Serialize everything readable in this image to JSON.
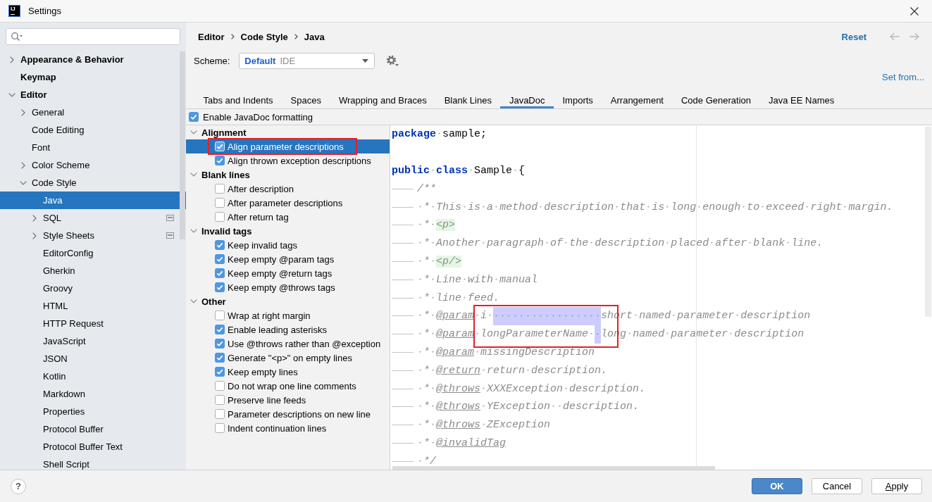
{
  "window": {
    "title": "Settings",
    "logo": "IJ"
  },
  "sidebar": {
    "items": [
      {
        "label": "Appearance & Behavior",
        "expanded": false,
        "selected": false
      },
      {
        "label": "Keymap",
        "selected": false
      },
      {
        "label": "Editor",
        "expanded": true,
        "selected": false,
        "children": [
          {
            "label": "General",
            "expanded": false,
            "selected": false
          },
          {
            "label": "Code Editing",
            "selected": false
          },
          {
            "label": "Font",
            "selected": false
          },
          {
            "label": "Color Scheme",
            "expanded": false,
            "selected": false
          },
          {
            "label": "Code Style",
            "expanded": true,
            "selected": false,
            "children": [
              {
                "label": "Java",
                "selected": true
              },
              {
                "label": "SQL",
                "expanded": false,
                "selected": false,
                "scheme_icon": true
              },
              {
                "label": "Style Sheets",
                "expanded": false,
                "selected": false,
                "scheme_icon": true
              },
              {
                "label": "EditorConfig",
                "selected": false
              },
              {
                "label": "Gherkin",
                "selected": false
              },
              {
                "label": "Groovy",
                "selected": false
              },
              {
                "label": "HTML",
                "selected": false
              },
              {
                "label": "HTTP Request",
                "selected": false
              },
              {
                "label": "JavaScript",
                "selected": false
              },
              {
                "label": "JSON",
                "selected": false
              },
              {
                "label": "Kotlin",
                "selected": false
              },
              {
                "label": "Markdown",
                "selected": false
              },
              {
                "label": "Properties",
                "selected": false
              },
              {
                "label": "Protocol Buffer",
                "selected": false
              },
              {
                "label": "Protocol Buffer Text",
                "selected": false
              },
              {
                "label": "Shell Script",
                "selected": false
              }
            ]
          }
        ]
      }
    ]
  },
  "header": {
    "breadcrumb": [
      "Editor",
      "Code Style",
      "Java"
    ],
    "reset": "Reset",
    "back": {
      "disabled": true
    },
    "forward": {
      "disabled": true
    },
    "scheme": {
      "label": "Scheme:",
      "value": "Default",
      "scope": "IDE"
    },
    "set_from": "Set from..."
  },
  "tabs": [
    {
      "label": "Tabs and Indents",
      "selected": false
    },
    {
      "label": "Spaces",
      "selected": false
    },
    {
      "label": "Wrapping and Braces",
      "selected": false
    },
    {
      "label": "Blank Lines",
      "selected": false
    },
    {
      "label": "JavaDoc",
      "selected": true
    },
    {
      "label": "Imports",
      "selected": false
    },
    {
      "label": "Arrangement",
      "selected": false
    },
    {
      "label": "Code Generation",
      "selected": false
    },
    {
      "label": "Java EE Names",
      "selected": false
    }
  ],
  "enable_javadoc": {
    "label": "Enable JavaDoc formatting",
    "checked": true
  },
  "options": [
    {
      "label": "Alignment",
      "expanded": true,
      "children": [
        {
          "label": "Align parameter descriptions",
          "checked": true,
          "selected": true,
          "highlighted": true
        },
        {
          "label": "Align thrown exception descriptions",
          "checked": true,
          "selected": false
        }
      ]
    },
    {
      "label": "Blank lines",
      "expanded": true,
      "children": [
        {
          "label": "After description",
          "checked": false,
          "selected": false
        },
        {
          "label": "After parameter descriptions",
          "checked": false,
          "selected": false
        },
        {
          "label": "After return tag",
          "checked": false,
          "selected": false
        }
      ]
    },
    {
      "label": "Invalid tags",
      "expanded": true,
      "children": [
        {
          "label": "Keep invalid tags",
          "checked": true,
          "selected": false
        },
        {
          "label": "Keep empty @param tags",
          "checked": true,
          "selected": false
        },
        {
          "label": "Keep empty @return tags",
          "checked": true,
          "selected": false
        },
        {
          "label": "Keep empty @throws tags",
          "checked": true,
          "selected": false
        }
      ]
    },
    {
      "label": "Other",
      "expanded": true,
      "children": [
        {
          "label": "Wrap at right margin",
          "checked": false,
          "selected": false
        },
        {
          "label": "Enable leading asterisks",
          "checked": true,
          "selected": false
        },
        {
          "label": "Use @throws rather than @exception",
          "checked": true,
          "selected": false
        },
        {
          "label": "Generate \"<p>\" on empty lines",
          "checked": true,
          "selected": false
        },
        {
          "label": "Keep empty lines",
          "checked": true,
          "selected": false
        },
        {
          "label": "Do not wrap one line comments",
          "checked": false,
          "selected": false
        },
        {
          "label": "Preserve line feeds",
          "checked": false,
          "selected": false
        },
        {
          "label": "Parameter descriptions on new line",
          "checked": false,
          "selected": false
        },
        {
          "label": "Indent continuation lines",
          "checked": false,
          "selected": false
        }
      ]
    }
  ],
  "editor": {
    "lines": [
      {
        "indent": false,
        "tokens": [
          {
            "kind": "keyword",
            "text": "package"
          },
          {
            "kind": "text",
            "text": " sample;"
          }
        ]
      },
      {
        "indent": false
      },
      {
        "indent": false,
        "tokens": [
          {
            "kind": "keyword",
            "text": "public"
          },
          {
            "kind": "keyword",
            "text": " class"
          },
          {
            "kind": "text",
            "text": " Sample {"
          }
        ]
      },
      {
        "indent": true,
        "tokens": [
          {
            "kind": "comment",
            "text": "/**"
          }
        ]
      },
      {
        "indent": true,
        "tokens": [
          {
            "kind": "comment",
            "text": " * This is a method description that is long enough to exceed right margin."
          }
        ]
      },
      {
        "indent": true,
        "tokens": [
          {
            "kind": "comment",
            "text": " * "
          },
          {
            "kind": "html_tag",
            "text": "<p>"
          }
        ]
      },
      {
        "indent": true,
        "tokens": [
          {
            "kind": "comment",
            "text": " * Another paragraph of the description placed after blank line."
          }
        ]
      },
      {
        "indent": true,
        "tokens": [
          {
            "kind": "comment",
            "text": " * "
          },
          {
            "kind": "html_tag",
            "text": "<p/>"
          }
        ]
      },
      {
        "indent": true,
        "tokens": [
          {
            "kind": "comment",
            "text": " * Line with manual"
          }
        ]
      },
      {
        "indent": true,
        "tokens": [
          {
            "kind": "comment",
            "text": " * line feed."
          }
        ]
      },
      {
        "indent": true,
        "framed": true,
        "tokens": [
          {
            "kind": "comment",
            "text": " * "
          },
          {
            "kind": "doc_tag",
            "text": "@param"
          },
          {
            "kind": "comment",
            "text": " i "
          },
          {
            "kind": "selection"
          },
          {
            "kind": "comment",
            "text": "short named parameter description"
          }
        ]
      },
      {
        "indent": true,
        "framed": true,
        "tokens": [
          {
            "kind": "comment",
            "text": " * "
          },
          {
            "kind": "doc_tag",
            "text": "@param"
          },
          {
            "kind": "comment",
            "text": " longParameterName "
          },
          {
            "kind": "selection"
          },
          {
            "kind": "comment",
            "text": "long named parameter description"
          }
        ]
      },
      {
        "indent": true,
        "tokens": [
          {
            "kind": "comment",
            "text": " * "
          },
          {
            "kind": "doc_tag",
            "text": "@param"
          },
          {
            "kind": "comment",
            "text": " missingDescription"
          }
        ]
      },
      {
        "indent": true,
        "tokens": [
          {
            "kind": "comment",
            "text": " * "
          },
          {
            "kind": "doc_tag",
            "text": "@return"
          },
          {
            "kind": "comment",
            "text": " return description."
          }
        ]
      },
      {
        "indent": true,
        "tokens": [
          {
            "kind": "comment",
            "text": " * "
          },
          {
            "kind": "doc_tag",
            "text": "@throws"
          },
          {
            "kind": "comment",
            "text": " XXXException description."
          }
        ]
      },
      {
        "indent": true,
        "tokens": [
          {
            "kind": "comment",
            "text": " * "
          },
          {
            "kind": "doc_tag",
            "text": "@throws"
          },
          {
            "kind": "comment",
            "text": " YException  description."
          }
        ]
      },
      {
        "indent": true,
        "tokens": [
          {
            "kind": "comment",
            "text": " * "
          },
          {
            "kind": "doc_tag",
            "text": "@throws"
          },
          {
            "kind": "comment",
            "text": " ZException"
          }
        ]
      },
      {
        "indent": true,
        "tokens": [
          {
            "kind": "comment",
            "text": " * "
          },
          {
            "kind": "doc_tag",
            "text": "@invalidTag"
          }
        ]
      },
      {
        "indent": true,
        "tokens": [
          {
            "kind": "comment",
            "text": " */"
          }
        ]
      }
    ]
  },
  "footer": {
    "help": "?",
    "buttons": [
      {
        "label": "OK",
        "kind": "primary",
        "mnemonic": false
      },
      {
        "label": "Cancel",
        "kind": "default",
        "mnemonic": false
      },
      {
        "label": "Apply",
        "kind": "default",
        "mnemonic": true
      }
    ]
  }
}
